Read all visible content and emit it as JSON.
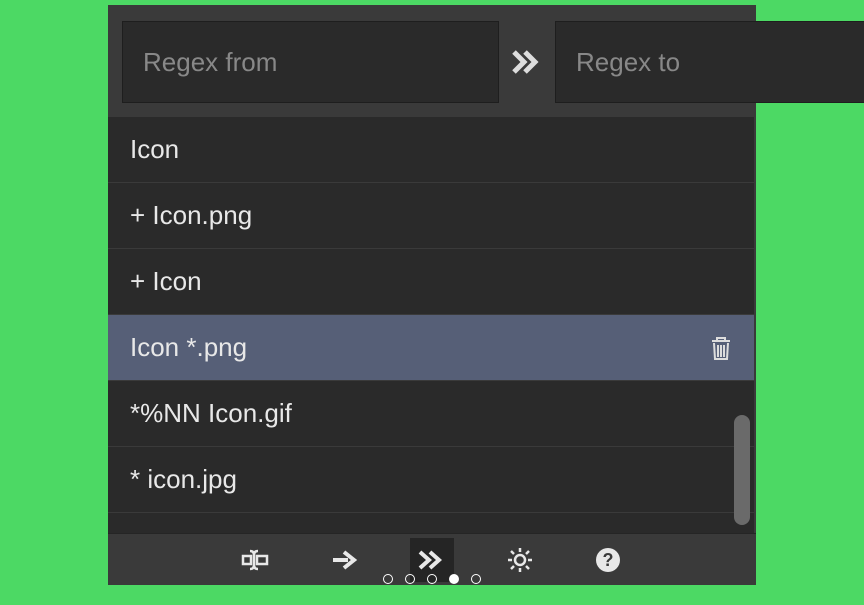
{
  "inputs": {
    "from_placeholder": "Regex from",
    "to_placeholder": "Regex to",
    "from_value": "",
    "to_value": ""
  },
  "list": {
    "items": [
      {
        "label": "Icon",
        "selected": false
      },
      {
        "label": "+ Icon.png",
        "selected": false
      },
      {
        "label": "+ Icon",
        "selected": false
      },
      {
        "label": "Icon *.png",
        "selected": true
      },
      {
        "label": "*%NN Icon.gif",
        "selected": false
      },
      {
        "label": "* icon.jpg",
        "selected": false
      }
    ]
  },
  "toolbar": {
    "buttons": [
      {
        "name": "text-cursor-icon",
        "active": false
      },
      {
        "name": "arrow-right-icon",
        "active": false
      },
      {
        "name": "double-arrow-right-icon",
        "active": true
      },
      {
        "name": "gear-icon",
        "active": false
      },
      {
        "name": "help-icon",
        "active": false
      }
    ]
  },
  "pager": {
    "count": 5,
    "active_index": 3
  }
}
